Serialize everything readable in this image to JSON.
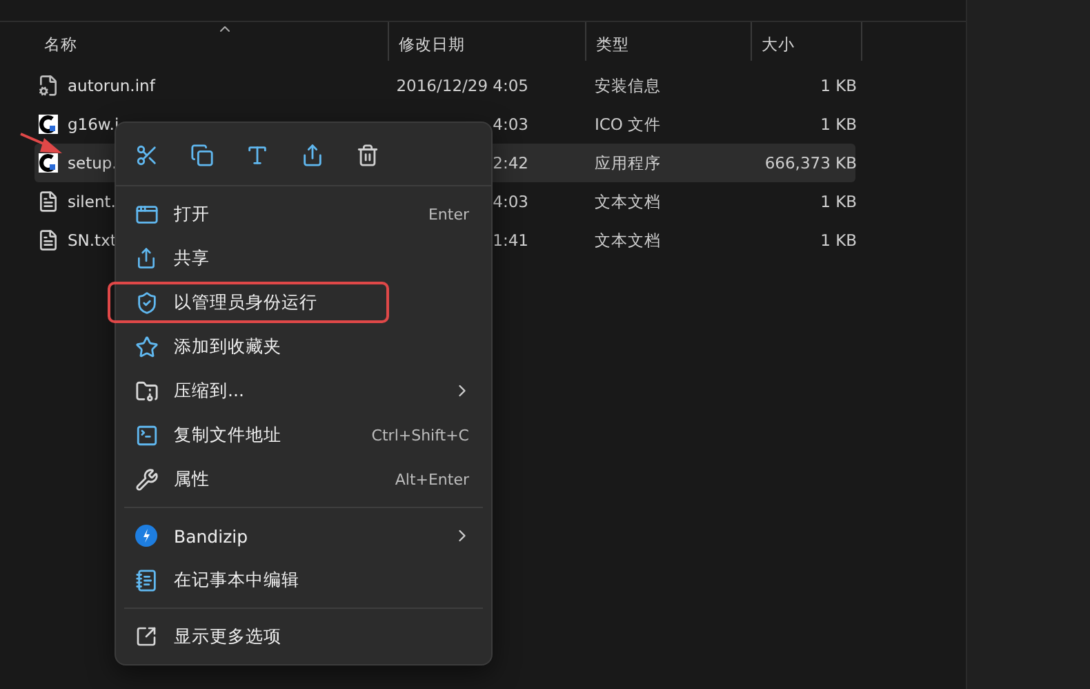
{
  "columns": [
    {
      "label": "名称",
      "sorted": true
    },
    {
      "label": "修改日期",
      "sorted": false
    },
    {
      "label": "类型",
      "sorted": false
    },
    {
      "label": "大小",
      "sorted": false
    }
  ],
  "files": [
    {
      "kind": "config",
      "name": "autorun.inf",
      "date": "2016/12/29 4:05",
      "type": "安装信息",
      "size": "1 KB",
      "selected": false
    },
    {
      "kind": "app",
      "name": "g16w.i",
      "date": "4:03",
      "type": "ICO 文件",
      "size": "1 KB",
      "selected": false
    },
    {
      "kind": "app",
      "name": "setup.",
      "date": "2:42",
      "type": "应用程序",
      "size": "666,373 KB",
      "selected": true
    },
    {
      "kind": "text",
      "name": "silent.",
      "date": "4:03",
      "type": "文本文档",
      "size": "1 KB",
      "selected": false
    },
    {
      "kind": "text",
      "name": "SN.txt",
      "date": "1:41",
      "type": "文本文档",
      "size": "1 KB",
      "selected": false
    }
  ],
  "context_menu": {
    "toolbar": [
      {
        "kind": "cut"
      },
      {
        "kind": "copy"
      },
      {
        "kind": "rename"
      },
      {
        "kind": "share"
      },
      {
        "kind": "delete"
      }
    ],
    "items": [
      {
        "kind": "open",
        "label": "打开",
        "shortcut": "Enter",
        "submenu": false,
        "highlighted": false
      },
      {
        "kind": "share",
        "label": "共享",
        "submenu": false,
        "highlighted": false
      },
      {
        "kind": "admin",
        "label": "以管理员身份运行",
        "submenu": false,
        "highlighted": true
      },
      {
        "kind": "star",
        "label": "添加到收藏夹",
        "submenu": false,
        "highlighted": false
      },
      {
        "kind": "zip",
        "label": "压缩到...",
        "submenu": true,
        "highlighted": false
      },
      {
        "kind": "path",
        "label": "复制文件地址",
        "shortcut": "Ctrl+Shift+C",
        "submenu": false,
        "highlighted": false
      },
      {
        "kind": "wrench",
        "label": "属性",
        "shortcut": "Alt+Enter",
        "submenu": false,
        "highlighted": false
      },
      {
        "kind": "separator"
      },
      {
        "kind": "bandizip",
        "label": "Bandizip",
        "submenu": true,
        "highlighted": false
      },
      {
        "kind": "notepad",
        "label": "在记事本中编辑",
        "submenu": false,
        "highlighted": false
      },
      {
        "kind": "separator"
      },
      {
        "kind": "more",
        "label": "显示更多选项",
        "submenu": false,
        "highlighted": false
      }
    ]
  }
}
